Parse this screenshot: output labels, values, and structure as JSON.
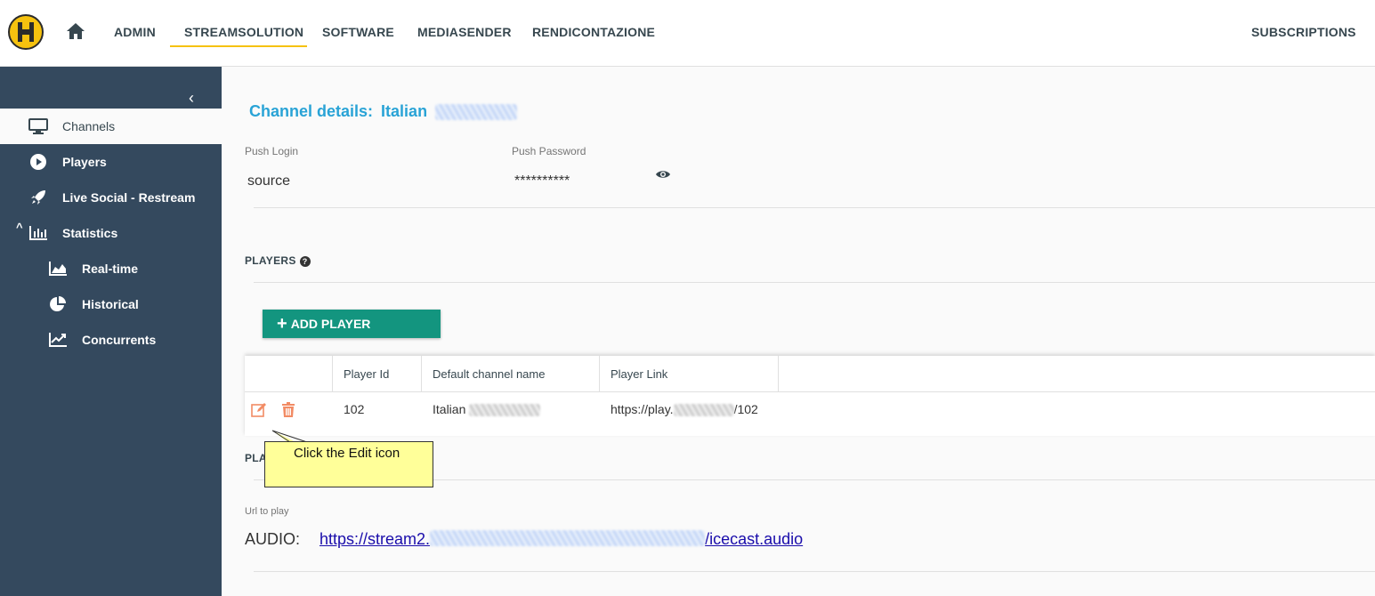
{
  "nav": {
    "items": [
      "ADMIN",
      "STREAMSOLUTION",
      "SOFTWARE",
      "MEDIASENDER",
      "RENDICONTAZIONE"
    ],
    "active": "STREAMSOLUTION",
    "right": "SUBSCRIPTIONS"
  },
  "sidebar": {
    "items": [
      {
        "label": "Channels",
        "icon": "monitor-icon",
        "active": true
      },
      {
        "label": "Players",
        "icon": "play-circle-icon"
      },
      {
        "label": "Live Social - Restream",
        "icon": "rocket-icon"
      },
      {
        "label": "Statistics",
        "icon": "bar-chart-icon",
        "expanded": true
      },
      {
        "label": "Real-time",
        "icon": "area-chart-icon"
      },
      {
        "label": "Historical",
        "icon": "pie-chart-icon"
      },
      {
        "label": "Concurrents",
        "icon": "line-chart-icon"
      }
    ]
  },
  "channel": {
    "title_prefix": "Channel details:",
    "name": "Italian",
    "push_login_label": "Push Login",
    "push_login_value": "source",
    "push_password_label": "Push Password",
    "push_password_value": "**********"
  },
  "players": {
    "section_label": "PLAYERS",
    "add_label": "ADD PLAYER",
    "columns": [
      "Player Id",
      "Default channel name",
      "Player Link"
    ],
    "rows": [
      {
        "id": "102",
        "channel_name": "Italian",
        "link_prefix": "https://play.",
        "link_suffix": "/102"
      }
    ]
  },
  "playback": {
    "section_label_partial": "PLA",
    "url_label": "Url to play",
    "audio_label": "AUDIO:",
    "link_prefix": "https://stream2.",
    "link_suffix": "/icecast.audio"
  },
  "callout": {
    "text": "Click the Edit icon"
  },
  "colors": {
    "sidebar": "#34495e",
    "accent": "#f6c20f",
    "title": "#29a3d6",
    "button": "#13957f",
    "action_icon": "#f28b64"
  }
}
